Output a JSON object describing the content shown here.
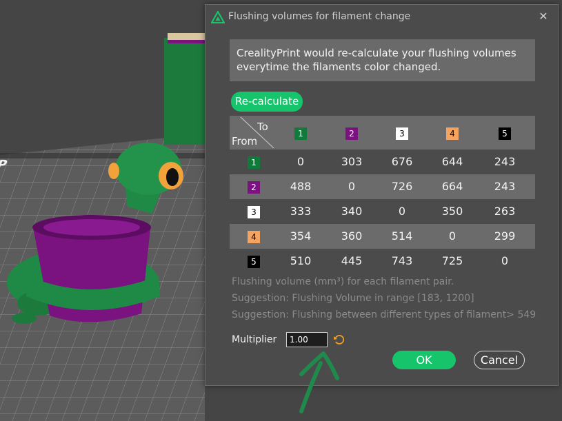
{
  "dialog": {
    "title": "Flushing volumes for filament change",
    "close_label": "✕",
    "info_text": "CrealityPrint would re-calculate your flushing volumes everytime the filaments color changed.",
    "recalc_label": "Re-calculate",
    "corner_to": "To",
    "corner_from": "From",
    "filaments": [
      {
        "label": "1",
        "color": "#0f7a3a",
        "text_color": "#ffffff"
      },
      {
        "label": "2",
        "color": "#7a1280",
        "text_color": "#ffffff"
      },
      {
        "label": "3",
        "color": "#ffffff",
        "text_color": "#000000"
      },
      {
        "label": "4",
        "color": "#f4a460",
        "text_color": "#000000"
      },
      {
        "label": "5",
        "color": "#000000",
        "text_color": "#ffffff"
      }
    ],
    "matrix": [
      [
        "0",
        "303",
        "676",
        "644",
        "243"
      ],
      [
        "488",
        "0",
        "726",
        "664",
        "243"
      ],
      [
        "333",
        "340",
        "0",
        "350",
        "263"
      ],
      [
        "354",
        "360",
        "514",
        "0",
        "299"
      ],
      [
        "510",
        "445",
        "743",
        "725",
        "0"
      ]
    ],
    "hints": [
      "Flushing volume (mm³) for each filament pair.",
      "Suggestion: Flushing Volume in range [183, 1200]",
      "Suggestion: Flushing between different types of filament> 549"
    ],
    "multiplier_label": "Multiplier",
    "multiplier_value": "1.00",
    "ok_label": "OK",
    "cancel_label": "Cancel"
  },
  "colors": {
    "accent": "#15c46b",
    "annotation": "#1f8a4c"
  }
}
